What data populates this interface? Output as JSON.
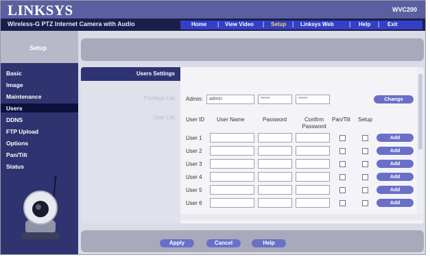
{
  "brand": "LINKSYS",
  "model": "WVC200",
  "subtitle": "Wireless-G PTZ Internet Camera with Audio",
  "nav": [
    "Home",
    "View Video",
    "Setup",
    "Linksys Web",
    "Help",
    "Exit"
  ],
  "nav_active": "Setup",
  "sidebar": {
    "heading": "Setup",
    "items": [
      "Basic",
      "Image",
      "Maintenance",
      "Users",
      "DDNS",
      "FTP Upload",
      "Options",
      "Pan/Tilt",
      "Status"
    ],
    "active": "Users"
  },
  "subtabs": [
    "Users Settings",
    "Privilege List",
    "User List"
  ],
  "admin": {
    "label": "Admin:",
    "name": "admin",
    "password": "*****",
    "confirm": "*****",
    "change_label": "Change"
  },
  "table": {
    "headers": [
      "User ID",
      "User Name",
      "Password",
      "Confirm Password",
      "Pan/Tilt",
      "Setup"
    ],
    "rows": [
      {
        "id": "User 1",
        "add": "Add"
      },
      {
        "id": "User 2",
        "add": "Add"
      },
      {
        "id": "User 3",
        "add": "Add"
      },
      {
        "id": "User 4",
        "add": "Add"
      },
      {
        "id": "User 5",
        "add": "Add"
      },
      {
        "id": "User 6",
        "add": "Add"
      }
    ]
  },
  "footer": {
    "apply": "Apply",
    "cancel": "Cancel",
    "help": "Help"
  },
  "colors": {
    "brand_bar": "#5a5fa0",
    "nav_bar": "#3340c6",
    "sidebar": "#2f3470",
    "button": "#6a70c7"
  }
}
